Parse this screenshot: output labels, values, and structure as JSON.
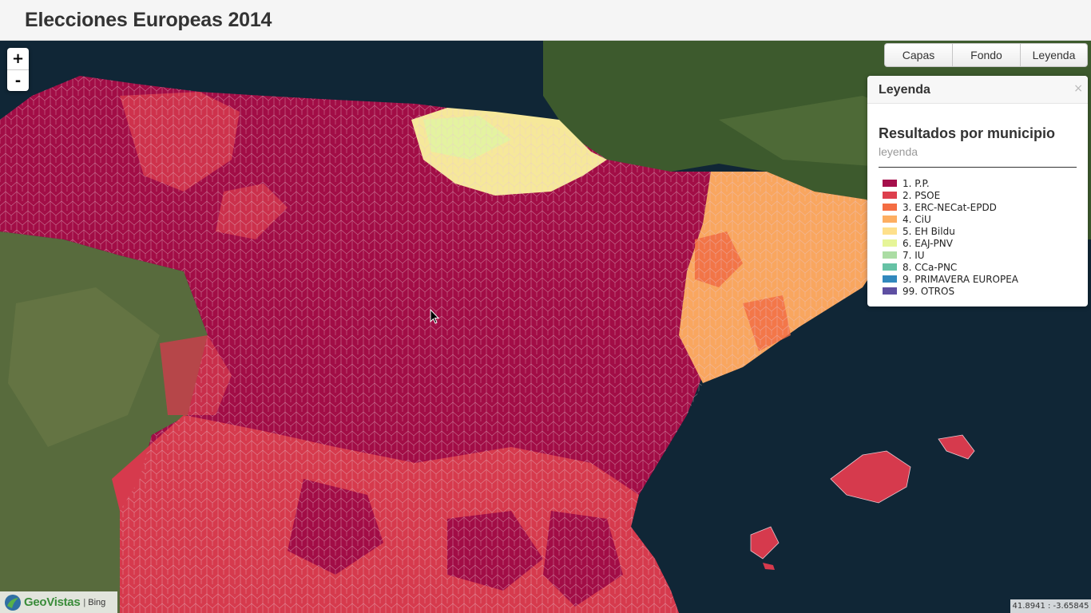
{
  "header": {
    "title": "Elecciones Europeas 2014"
  },
  "zoom": {
    "in_label": "+",
    "out_label": "-"
  },
  "toolbar": {
    "buttons": [
      "Capas",
      "Fondo",
      "Leyenda"
    ]
  },
  "legend_panel": {
    "title": "Leyenda",
    "close_label": "×",
    "results_title": "Resultados por municipio",
    "results_subtitle": "leyenda",
    "items": [
      {
        "label": "1. P.P.",
        "color": "#a50f4b"
      },
      {
        "label": "2. PSOE",
        "color": "#dd3f4d"
      },
      {
        "label": "3. ERC-NECat-EPDD",
        "color": "#f46d43"
      },
      {
        "label": "4. CiU",
        "color": "#fdae61"
      },
      {
        "label": "5. EH Bildu",
        "color": "#fee08b"
      },
      {
        "label": "6. EAJ-PNV",
        "color": "#e6f598"
      },
      {
        "label": "7. IU",
        "color": "#abdda4"
      },
      {
        "label": "8. CCa-PNC",
        "color": "#66c2a5"
      },
      {
        "label": "9. PRIMAVERA EUROPEA",
        "color": "#3288bd"
      },
      {
        "label": "99. OTROS",
        "color": "#5e4fa2"
      }
    ]
  },
  "attribution": {
    "logo_text": "GeoVistas",
    "separator": "|",
    "provider": "Bing"
  },
  "coordinates": "41.8941 : -3.65845",
  "map": {
    "sea_color": "#0f2433",
    "portugal_land": "#55673a",
    "france_land": "#3f5a2e"
  }
}
